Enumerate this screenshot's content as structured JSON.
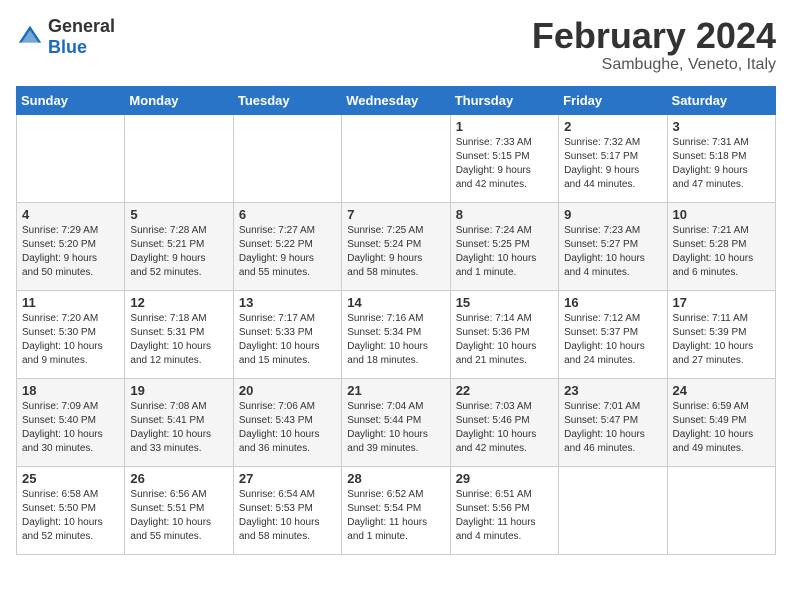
{
  "logo": {
    "general": "General",
    "blue": "Blue"
  },
  "title": "February 2024",
  "subtitle": "Sambughe, Veneto, Italy",
  "headers": [
    "Sunday",
    "Monday",
    "Tuesday",
    "Wednesday",
    "Thursday",
    "Friday",
    "Saturday"
  ],
  "weeks": [
    [
      {
        "day": "",
        "info": ""
      },
      {
        "day": "",
        "info": ""
      },
      {
        "day": "",
        "info": ""
      },
      {
        "day": "",
        "info": ""
      },
      {
        "day": "1",
        "info": "Sunrise: 7:33 AM\nSunset: 5:15 PM\nDaylight: 9 hours\nand 42 minutes."
      },
      {
        "day": "2",
        "info": "Sunrise: 7:32 AM\nSunset: 5:17 PM\nDaylight: 9 hours\nand 44 minutes."
      },
      {
        "day": "3",
        "info": "Sunrise: 7:31 AM\nSunset: 5:18 PM\nDaylight: 9 hours\nand 47 minutes."
      }
    ],
    [
      {
        "day": "4",
        "info": "Sunrise: 7:29 AM\nSunset: 5:20 PM\nDaylight: 9 hours\nand 50 minutes."
      },
      {
        "day": "5",
        "info": "Sunrise: 7:28 AM\nSunset: 5:21 PM\nDaylight: 9 hours\nand 52 minutes."
      },
      {
        "day": "6",
        "info": "Sunrise: 7:27 AM\nSunset: 5:22 PM\nDaylight: 9 hours\nand 55 minutes."
      },
      {
        "day": "7",
        "info": "Sunrise: 7:25 AM\nSunset: 5:24 PM\nDaylight: 9 hours\nand 58 minutes."
      },
      {
        "day": "8",
        "info": "Sunrise: 7:24 AM\nSunset: 5:25 PM\nDaylight: 10 hours\nand 1 minute."
      },
      {
        "day": "9",
        "info": "Sunrise: 7:23 AM\nSunset: 5:27 PM\nDaylight: 10 hours\nand 4 minutes."
      },
      {
        "day": "10",
        "info": "Sunrise: 7:21 AM\nSunset: 5:28 PM\nDaylight: 10 hours\nand 6 minutes."
      }
    ],
    [
      {
        "day": "11",
        "info": "Sunrise: 7:20 AM\nSunset: 5:30 PM\nDaylight: 10 hours\nand 9 minutes."
      },
      {
        "day": "12",
        "info": "Sunrise: 7:18 AM\nSunset: 5:31 PM\nDaylight: 10 hours\nand 12 minutes."
      },
      {
        "day": "13",
        "info": "Sunrise: 7:17 AM\nSunset: 5:33 PM\nDaylight: 10 hours\nand 15 minutes."
      },
      {
        "day": "14",
        "info": "Sunrise: 7:16 AM\nSunset: 5:34 PM\nDaylight: 10 hours\nand 18 minutes."
      },
      {
        "day": "15",
        "info": "Sunrise: 7:14 AM\nSunset: 5:36 PM\nDaylight: 10 hours\nand 21 minutes."
      },
      {
        "day": "16",
        "info": "Sunrise: 7:12 AM\nSunset: 5:37 PM\nDaylight: 10 hours\nand 24 minutes."
      },
      {
        "day": "17",
        "info": "Sunrise: 7:11 AM\nSunset: 5:39 PM\nDaylight: 10 hours\nand 27 minutes."
      }
    ],
    [
      {
        "day": "18",
        "info": "Sunrise: 7:09 AM\nSunset: 5:40 PM\nDaylight: 10 hours\nand 30 minutes."
      },
      {
        "day": "19",
        "info": "Sunrise: 7:08 AM\nSunset: 5:41 PM\nDaylight: 10 hours\nand 33 minutes."
      },
      {
        "day": "20",
        "info": "Sunrise: 7:06 AM\nSunset: 5:43 PM\nDaylight: 10 hours\nand 36 minutes."
      },
      {
        "day": "21",
        "info": "Sunrise: 7:04 AM\nSunset: 5:44 PM\nDaylight: 10 hours\nand 39 minutes."
      },
      {
        "day": "22",
        "info": "Sunrise: 7:03 AM\nSunset: 5:46 PM\nDaylight: 10 hours\nand 42 minutes."
      },
      {
        "day": "23",
        "info": "Sunrise: 7:01 AM\nSunset: 5:47 PM\nDaylight: 10 hours\nand 46 minutes."
      },
      {
        "day": "24",
        "info": "Sunrise: 6:59 AM\nSunset: 5:49 PM\nDaylight: 10 hours\nand 49 minutes."
      }
    ],
    [
      {
        "day": "25",
        "info": "Sunrise: 6:58 AM\nSunset: 5:50 PM\nDaylight: 10 hours\nand 52 minutes."
      },
      {
        "day": "26",
        "info": "Sunrise: 6:56 AM\nSunset: 5:51 PM\nDaylight: 10 hours\nand 55 minutes."
      },
      {
        "day": "27",
        "info": "Sunrise: 6:54 AM\nSunset: 5:53 PM\nDaylight: 10 hours\nand 58 minutes."
      },
      {
        "day": "28",
        "info": "Sunrise: 6:52 AM\nSunset: 5:54 PM\nDaylight: 11 hours\nand 1 minute."
      },
      {
        "day": "29",
        "info": "Sunrise: 6:51 AM\nSunset: 5:56 PM\nDaylight: 11 hours\nand 4 minutes."
      },
      {
        "day": "",
        "info": ""
      },
      {
        "day": "",
        "info": ""
      }
    ]
  ]
}
